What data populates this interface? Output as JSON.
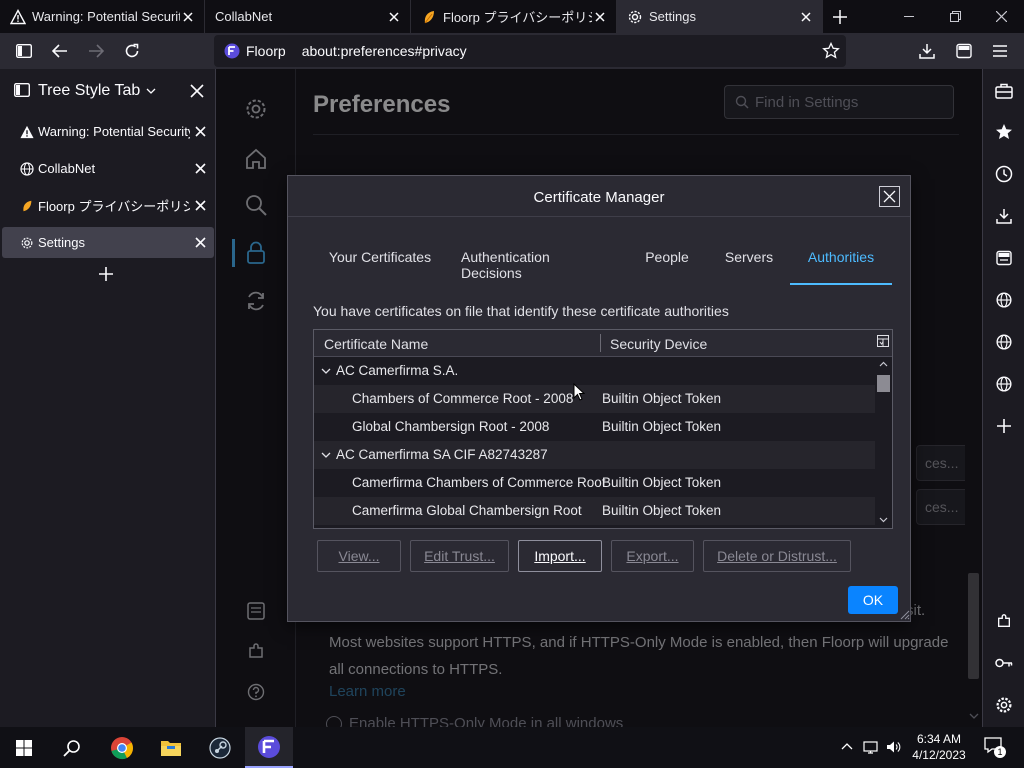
{
  "tabs": [
    {
      "title": "Warning: Potential Security Risk Ahead",
      "icon": "warning-icon"
    },
    {
      "title": "CollabNet",
      "icon": "globe-icon"
    },
    {
      "title": "Floorp プライバシーポリシー",
      "icon": "floorp-leaf-icon"
    },
    {
      "title": "Settings",
      "icon": "gear-icon",
      "active": true
    }
  ],
  "navbar": {
    "identity": "Floorp",
    "url": "about:preferences#privacy"
  },
  "tree_style_tab": {
    "header": "Tree Style Tab",
    "items": [
      {
        "label": "Warning: Potential Security Risk Ahead",
        "icon": "warning-icon"
      },
      {
        "label": "CollabNet",
        "icon": "globe-icon"
      },
      {
        "label": "Floorp プライバシーポリシー",
        "icon": "floorp-leaf-icon"
      },
      {
        "label": "Settings",
        "icon": "gear-icon",
        "active": true
      }
    ]
  },
  "preferences": {
    "title": "Preferences",
    "search_placeholder": "Find in Settings",
    "https_text": "Most websites support HTTPS, and if HTTPS-Only Mode is enabled, then Floorp will upgrade all connections to HTTPS.",
    "https_text_tail": "sit.",
    "learn_more": "Learn more",
    "https_radio": "Enable HTTPS-Only Mode in all windows",
    "bg_button_1": "ces...",
    "bg_button_2": "ces..."
  },
  "dialog": {
    "title": "Certificate Manager",
    "tabs": [
      "Your Certificates",
      "Authentication Decisions",
      "People",
      "Servers",
      "Authorities"
    ],
    "active_tab": "Authorities",
    "description": "You have certificates on file that identify these certificate authorities",
    "columns": [
      "Certificate Name",
      "Security Device"
    ],
    "rows": [
      {
        "type": "group",
        "name": "AC Camerfirma S.A.",
        "device": ""
      },
      {
        "type": "child",
        "name": "Chambers of Commerce Root - 2008",
        "device": "Builtin Object Token"
      },
      {
        "type": "child",
        "name": "Global Chambersign Root - 2008",
        "device": "Builtin Object Token"
      },
      {
        "type": "group",
        "name": "AC Camerfirma SA CIF A82743287",
        "device": ""
      },
      {
        "type": "child",
        "name": "Camerfirma Chambers of Commerce Root",
        "device": "Builtin Object Token"
      },
      {
        "type": "child",
        "name": "Camerfirma Global Chambersign Root",
        "device": "Builtin Object Token"
      }
    ],
    "buttons": {
      "view": "View...",
      "edit_trust": "Edit Trust...",
      "import": "Import...",
      "export": "Export...",
      "delete": "Delete or Distrust...",
      "ok": "OK"
    }
  },
  "taskbar": {
    "time": "6:34 AM",
    "date": "4/12/2023",
    "notification_count": "1"
  },
  "colors": {
    "accent": "#4dbbff",
    "ok_button": "#0a84ff",
    "dialog_bg": "#2b2a33",
    "page_bg": "#1c1b22"
  }
}
